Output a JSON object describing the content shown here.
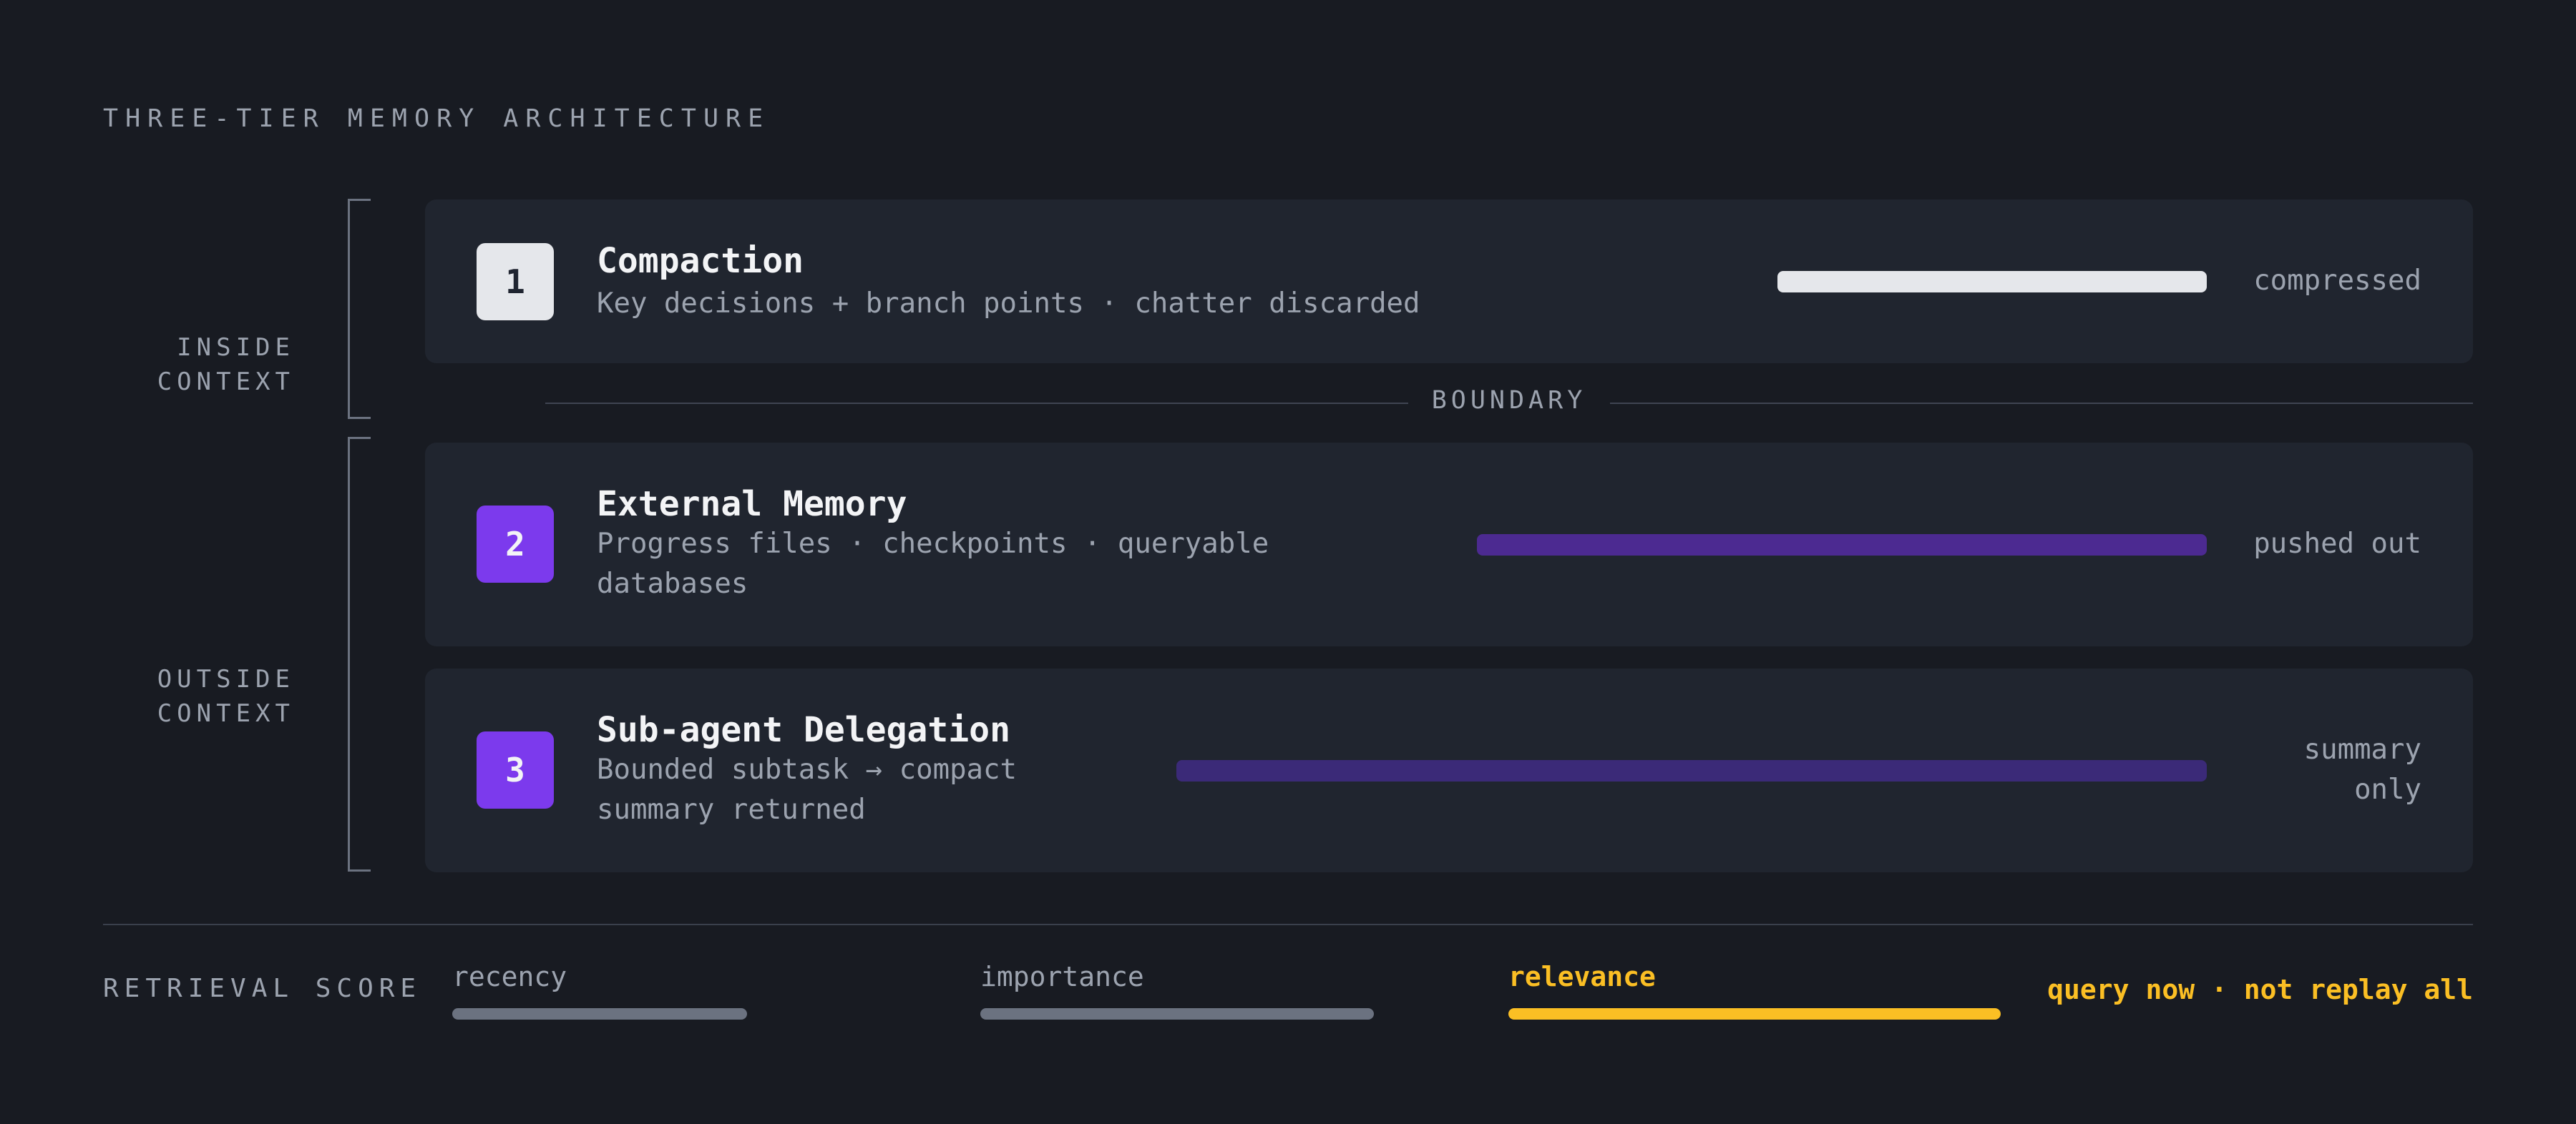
{
  "header": {
    "eyebrow": "THREE-TIER MEMORY ARCHITECTURE"
  },
  "groups": {
    "inside": {
      "line1": "INSIDE",
      "line2": "CONTEXT"
    },
    "outside": {
      "line1": "OUTSIDE",
      "line2": "CONTEXT"
    }
  },
  "boundary_label": "BOUNDARY",
  "tiers": [
    {
      "number": "1",
      "title": "Compaction",
      "description": "Key decisions + branch points · chatter discarded",
      "status": "compressed",
      "bar_color": "#e5e7eb"
    },
    {
      "number": "2",
      "title": "External Memory",
      "description": "Progress files · checkpoints · queryable databases",
      "status": "pushed out",
      "bar_color": "#4c2a91"
    },
    {
      "number": "3",
      "title": "Sub-agent Delegation",
      "description": "Bounded subtask → compact summary returned",
      "status": "summary only",
      "bar_color": "#3b2a78"
    }
  ],
  "retrieval": {
    "label": "RETRIEVAL SCORE",
    "metrics": [
      {
        "name": "recency",
        "highlighted": false
      },
      {
        "name": "importance",
        "highlighted": false
      },
      {
        "name": "relevance",
        "highlighted": true
      }
    ],
    "tagline": "query now · not replay all"
  },
  "colors": {
    "background": "#181b22",
    "card": "#20252f",
    "accent_purple": "#7c3aed",
    "accent_yellow": "#fbbf24",
    "muted_text": "#9ca3af"
  }
}
